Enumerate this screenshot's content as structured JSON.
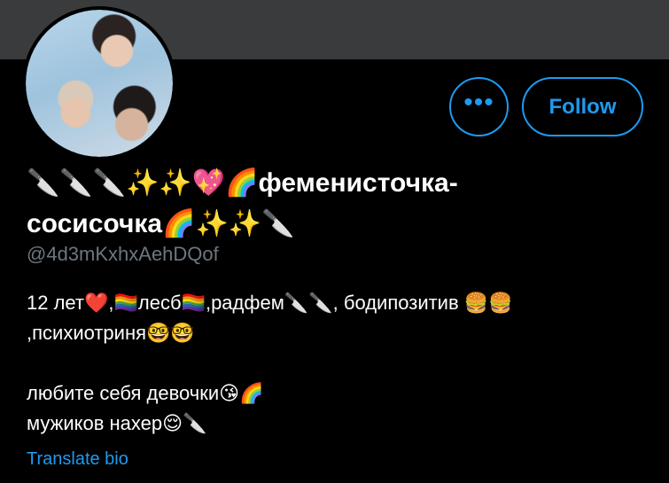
{
  "profile": {
    "display_name_line1": "🔪🔪🔪✨✨💖🌈фемeнисточка-",
    "display_name_line2": "сосисочка🌈✨✨🔪",
    "handle": "@4d3mKxhxAehDQof",
    "bio_lines": [
      "12 лет❤️,🏳️‍🌈лесб🏳️‍🌈,радфем🔪🔪, бодипозитив 🍔🍔",
      ",психиотриня🤓🤓",
      "",
      "любите себя девочки😘🌈",
      "мужиков нахер😌🔪"
    ],
    "translate_label": "Translate bio"
  },
  "actions": {
    "more_label": "•••",
    "follow_label": "Follow"
  },
  "colors": {
    "background": "#000000",
    "banner": "#3a3b3d",
    "accent": "#1d9bf0",
    "muted": "#6e767d"
  }
}
